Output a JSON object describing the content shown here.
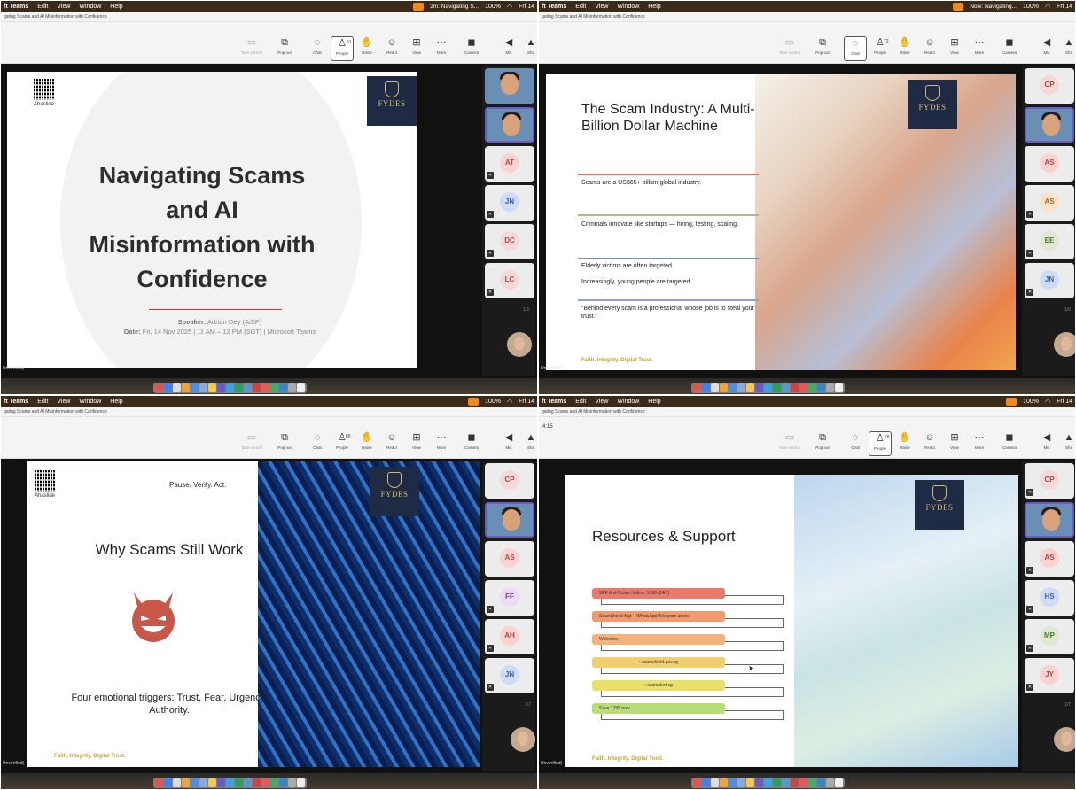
{
  "app": {
    "menu": [
      "Edit",
      "View",
      "Window",
      "Help"
    ],
    "menu_app": "ft Teams",
    "window_title": "gating Scams and AI Misinformation with Confidence",
    "clock": "Fri 14",
    "battery": "100%",
    "toolbar_labels": {
      "take_control": "Take control",
      "pop_out": "Pop out",
      "chat": "Chat",
      "people": "People",
      "raise": "Raise",
      "react": "React",
      "view": "View",
      "more": "More",
      "camera": "Camera",
      "mic": "Mic",
      "share": "Sha"
    },
    "unverified": "Unverified)"
  },
  "panels": [
    {
      "meeting_chip": "2m: Navigating S...",
      "people_count": "31",
      "participants": [
        "AT",
        "JN",
        "DC",
        "LC"
      ],
      "pager": "1/3",
      "slide": {
        "qr_label": "Ahaslide",
        "title": "Navigating Scams and AI Misinformation with Confidence",
        "speaker_label": "Speaker:",
        "speaker": "Adrian Oey (AiSP)",
        "date_label": "Date:",
        "date": "Fri, 14 Nov 2025 | 11 AM – 12 PM (SGT) | Microsoft Teams",
        "logo": "FYDES"
      }
    },
    {
      "meeting_chip": "Now: Navigating...",
      "people_count": "72",
      "participants": [
        "CP",
        "AS",
        "AS",
        "EE",
        "JN"
      ],
      "pager": "1/6",
      "slide": {
        "title": "The Scam Industry: A Multi-Billion Dollar Machine",
        "bullets": [
          "Scams are a US$65+ billion global industry.",
          "Criminals innovate like startups — hiring, testing, scaling.",
          "Elderly victims are often targeted.",
          "Increasingly, young people are targeted.",
          "“Behind every scam is a professional whose job is to steal your trust.”"
        ],
        "tagline": "Faith. Integrity. Digital Trust.",
        "logo": "FYDES"
      }
    },
    {
      "people_count": "85",
      "participants": [
        "CP",
        "AS",
        "FF",
        "AH",
        "JN"
      ],
      "pager": "1/7",
      "slide": {
        "qr_label": "Ahaslide",
        "top_text": "Pause. Verify. Act.",
        "title": "Why Scams Still Work",
        "body": "Four emotional triggers: Trust, Fear, Urgency, Authority.",
        "tagline": "Faith. Integrity. Digital Trust.",
        "logo": "FYDES"
      }
    },
    {
      "timer": "4:15",
      "people_count": "78",
      "participants": [
        "CP",
        "AS",
        "HS",
        "MP",
        "JY"
      ],
      "pager": "1/7",
      "slide": {
        "title": "Resources & Support",
        "items": [
          {
            "text": "SPF Anti-Scam Hotline: 1799 (24/7)",
            "color": "#ea7b6c"
          },
          {
            "text": "ScamShield App – WhatsApp/Telegram alerts.",
            "color": "#f09a6e"
          },
          {
            "text": "Websites:",
            "color": "#f3b17e"
          },
          {
            "text": "• scamshield.gov.sg",
            "color": "#f2cf6e"
          },
          {
            "text": "• scamalert.sg",
            "color": "#e8e06a"
          },
          {
            "text": "Save 1799 now.",
            "color": "#b8dc76"
          }
        ],
        "tagline": "Faith. Integrity. Digital Trust.",
        "logo": "FYDES"
      }
    }
  ]
}
